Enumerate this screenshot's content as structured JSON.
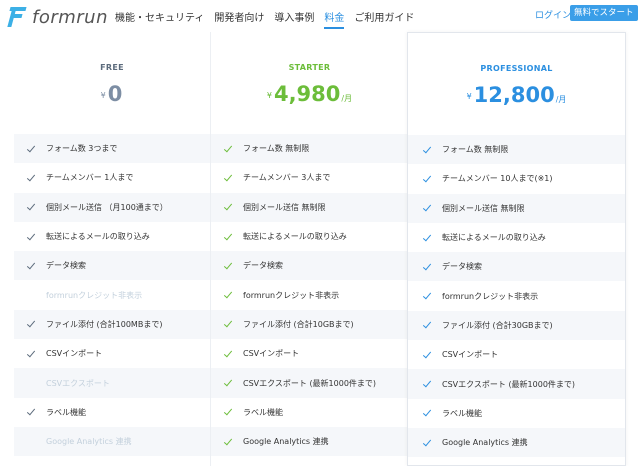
{
  "brand": {
    "logo_text": "formrun",
    "accent": "#2b8fe0",
    "starter_color": "#6cbd3a"
  },
  "nav": [
    {
      "label": "機能・セキュリティ",
      "active": false
    },
    {
      "label": "開発者向け",
      "active": false
    },
    {
      "label": "導入事例",
      "active": false
    },
    {
      "label": "料金",
      "active": true
    },
    {
      "label": "ご利用ガイド",
      "active": false
    }
  ],
  "header": {
    "login": "ログイン",
    "cta": "無料でスタート"
  },
  "plans": [
    {
      "name": "FREE",
      "currency": "¥",
      "price": "0",
      "per": "",
      "features": [
        {
          "label": "フォーム数 3つまで",
          "enabled": true
        },
        {
          "label": "チームメンバー 1人まで",
          "enabled": true
        },
        {
          "label": "個別メール送信 （月100通まで）",
          "enabled": true
        },
        {
          "label": "転送によるメールの取り込み",
          "enabled": true
        },
        {
          "label": "データ検索",
          "enabled": true
        },
        {
          "label": "formrunクレジット非表示",
          "enabled": false
        },
        {
          "label": "ファイル添付 (合計100MBまで)",
          "enabled": true
        },
        {
          "label": "CSVインポート",
          "enabled": true
        },
        {
          "label": "CSVエクスポート",
          "enabled": false
        },
        {
          "label": "ラベル機能",
          "enabled": true
        },
        {
          "label": "Google Analytics 連携",
          "enabled": false
        }
      ]
    },
    {
      "name": "STARTER",
      "currency": "¥",
      "price": "4,980",
      "per": "/月",
      "features": [
        {
          "label": "フォーム数 無制限",
          "enabled": true
        },
        {
          "label": "チームメンバー 3人まで",
          "enabled": true
        },
        {
          "label": "個別メール送信 無制限",
          "enabled": true
        },
        {
          "label": "転送によるメールの取り込み",
          "enabled": true
        },
        {
          "label": "データ検索",
          "enabled": true
        },
        {
          "label": "formrunクレジット非表示",
          "enabled": true
        },
        {
          "label": "ファイル添付 (合計10GBまで)",
          "enabled": true
        },
        {
          "label": "CSVインポート",
          "enabled": true
        },
        {
          "label": "CSVエクスポート (最新1000件まで)",
          "enabled": true
        },
        {
          "label": "ラベル機能",
          "enabled": true
        },
        {
          "label": "Google Analytics 連携",
          "enabled": true
        }
      ]
    },
    {
      "name": "PROFESSIONAL",
      "currency": "¥",
      "price": "12,800",
      "per": "/月",
      "features": [
        {
          "label": "フォーム数 無制限",
          "enabled": true
        },
        {
          "label": "チームメンバー 10人まで(※1)",
          "enabled": true
        },
        {
          "label": "個別メール送信 無制限",
          "enabled": true
        },
        {
          "label": "転送によるメールの取り込み",
          "enabled": true
        },
        {
          "label": "データ検索",
          "enabled": true
        },
        {
          "label": "formrunクレジット非表示",
          "enabled": true
        },
        {
          "label": "ファイル添付 (合計30GBまで)",
          "enabled": true
        },
        {
          "label": "CSVインポート",
          "enabled": true
        },
        {
          "label": "CSVエクスポート (最新1000件まで)",
          "enabled": true
        },
        {
          "label": "ラベル機能",
          "enabled": true
        },
        {
          "label": "Google Analytics 連携",
          "enabled": true
        }
      ]
    }
  ]
}
